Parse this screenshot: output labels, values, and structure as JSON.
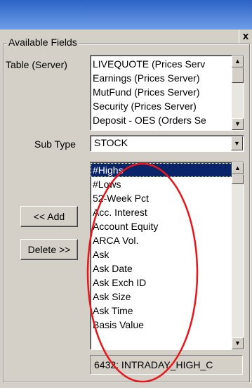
{
  "window": {
    "close_glyph": "x"
  },
  "group": {
    "legend": "Available Fields"
  },
  "table_server": {
    "label": "Table (Server)",
    "items": [
      "LIVEQUOTE (Prices Serv",
      "Earnings (Prices Server)",
      "MutFund (Prices Server)",
      "Security (Prices Server)",
      "Deposit - OES (Orders Se"
    ]
  },
  "sub_type": {
    "label": "Sub Type",
    "value": "STOCK"
  },
  "fields": {
    "items": [
      "#Highs",
      "#Lows",
      "52-Week Pct",
      "Acc. Interest",
      "Account Equity",
      "ARCA Vol.",
      "Ask",
      "Ask Date",
      "Ask Exch ID",
      "Ask Size",
      "Ask Time",
      "Basis Value"
    ],
    "selected_index": 0
  },
  "buttons": {
    "add_label": "<< Add",
    "delete_label": "Delete >>"
  },
  "status": {
    "value": "6432: INTRADAY_HIGH_C"
  },
  "icons": {
    "scroll_up": "▲",
    "scroll_down": "▼",
    "dropdown": "▼"
  },
  "colors": {
    "selection": "#0a246a",
    "annotation": "#e8161b"
  }
}
